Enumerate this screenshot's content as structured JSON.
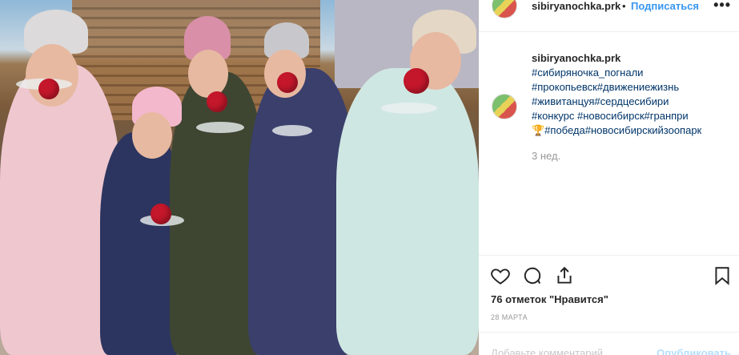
{
  "post": {
    "username": "sibiryanochka.prk",
    "separator": "•",
    "follow_label": "Подписаться",
    "more_label": "•••",
    "caption": {
      "username": "sibiryanochka.prk",
      "tags": [
        "#сибиряночка_погнали",
        "#прокопьевск#движениежизнь",
        "#живитанцуя#сердцесибири",
        "#конкурс #новосибирск#гранпри",
        "🏆#победа#новосибирскийзоопарк"
      ]
    },
    "time_ago": "3 нед.",
    "likes": "76 отметок \"Нравится\"",
    "date": "28 марта",
    "comment": {
      "placeholder": "Добавьте комментарий...",
      "publish_label": "Опубликовать"
    }
  },
  "icons": {
    "like": "heart-icon",
    "comment": "comment-icon",
    "share": "share-icon",
    "save": "bookmark-icon"
  },
  "colors": {
    "link": "#003569",
    "follow": "#3897f0",
    "publish_disabled": "#b2dffc",
    "muted": "#999999"
  }
}
